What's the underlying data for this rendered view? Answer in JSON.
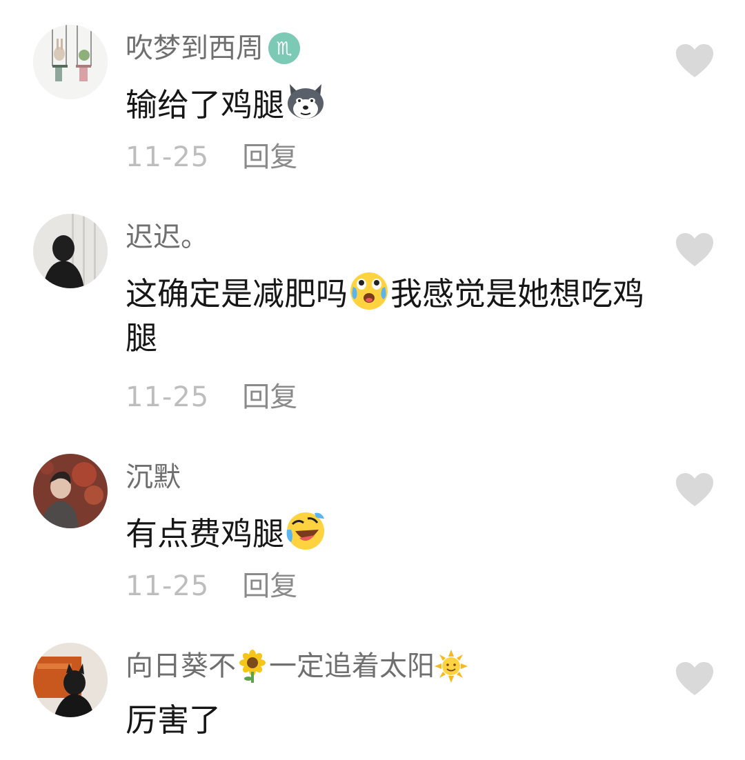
{
  "comments": [
    {
      "username": "吹梦到西周",
      "username_badge": "scorpio-zodiac-badge",
      "text_before_emoji": "输给了鸡腿",
      "emoji": "husky-dog-face-emoji",
      "date": "11-25",
      "reply_label": "回复"
    },
    {
      "username": "迟迟。",
      "text_before_emoji": "这确定是减肥吗",
      "emoji": "crying-pleading-face-emoji",
      "text_after_emoji": "我感觉是她想吃鸡腿",
      "date": "11-25",
      "reply_label": "回复"
    },
    {
      "username": "沉默",
      "text_before_emoji": "有点费鸡腿",
      "emoji": "rolling-laughing-face-emoji",
      "date": "11-25",
      "reply_label": "回复"
    },
    {
      "username_part1": "向日葵不",
      "username_part2": "一定追着太阳",
      "username_icons": [
        "sunflower-icon",
        "sun-face-icon"
      ],
      "text": "厉害了"
    }
  ],
  "colors": {
    "username": "#6f6f6f",
    "text": "#161616",
    "date": "#bdbdbd",
    "reply": "#8a8a8a",
    "like_icon": "#d9d9d9",
    "badge": "#7cc9b5"
  },
  "icons": {
    "like": "heart-icon"
  }
}
